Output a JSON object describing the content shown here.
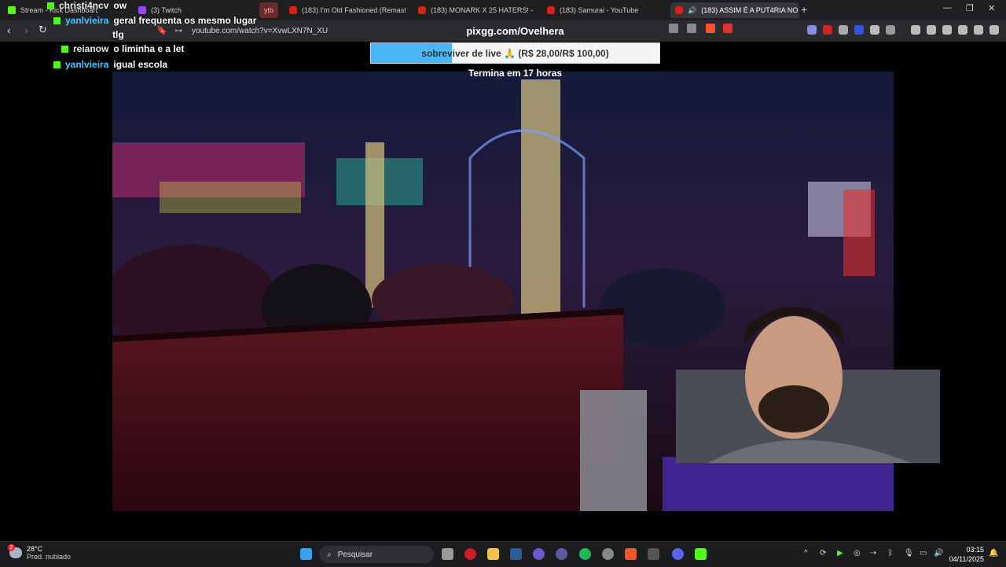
{
  "browser": {
    "tabs": [
      {
        "label": "Stream - Kick Dashboard",
        "icon": "kick-icon"
      },
      {
        "label": "(3) Twitch",
        "icon": "twitch-icon"
      },
      {
        "label": "ytb",
        "icon": "tab-group-label"
      },
      {
        "label": "(183) I'm Old Fashioned (Remastered",
        "icon": "youtube-icon"
      },
      {
        "label": "(183) MONARK X 25 HATERS! - YouT",
        "icon": "youtube-icon"
      },
      {
        "label": "(183) Samurai - YouTube",
        "icon": "youtube-icon"
      },
      {
        "label": "(183) ASSIM É A PUT4RIA NO",
        "icon": "youtube-icon",
        "active": true
      }
    ],
    "url": "youtube.com/watch?v=XvwLXN7N_XU"
  },
  "chat": [
    {
      "user": "christi4ncv",
      "message": "ow"
    },
    {
      "user": "yanlvieira",
      "message": "geral frequenta os mesmo lugar"
    },
    {
      "user": "",
      "message": "tlg"
    },
    {
      "user": "reianow",
      "message": "o liminha e a let"
    },
    {
      "user": "yanlvieira",
      "message": "igual escola"
    }
  ],
  "donation": {
    "title": "pixgg.com/Ovelhera",
    "goal_text": "sobreviver de live 🙏 (R$ 28,00/R$ 100,00)",
    "progress": 0.28,
    "timer": "Termina em 17 horas"
  },
  "colors": {
    "chat_user": "#4ac6ff",
    "kick_green": "#53fc18",
    "progress_fill": "#4ab6f6"
  },
  "taskbar": {
    "temperature": "28°C",
    "weather": "Pred. nublado",
    "weather_badge": "2",
    "search_placeholder": "Pesquisar",
    "time": "03:15",
    "date": "04/11/2025"
  }
}
